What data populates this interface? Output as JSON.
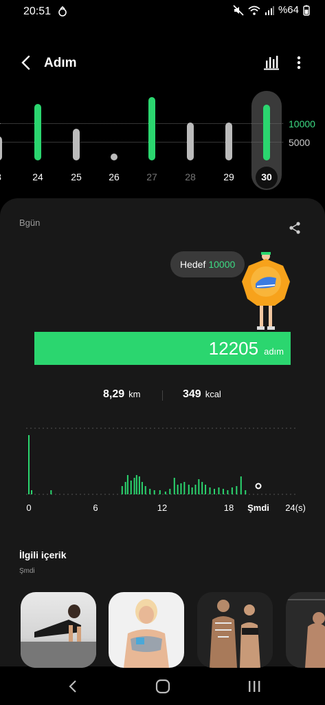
{
  "status_bar": {
    "time": "20:51",
    "battery": "%64"
  },
  "header": {
    "title": "Adım"
  },
  "daily_chart": {
    "goal_labels": [
      "10000",
      "5000"
    ],
    "days": [
      {
        "label": "3",
        "steps": 3000
      },
      {
        "label": "24",
        "steps": 12500
      },
      {
        "label": "25",
        "steps": 5300
      },
      {
        "label": "26",
        "steps": 0
      },
      {
        "label": "27",
        "steps": 14500
      },
      {
        "label": "28",
        "steps": 7000
      },
      {
        "label": "29",
        "steps": 7000
      },
      {
        "label": "30",
        "steps": 12205
      }
    ],
    "selected_day": "30"
  },
  "card": {
    "date_label": "Bgün",
    "goal_prefix": "Hedef",
    "goal_value": "10000",
    "steps_value": "12205",
    "steps_unit": "adım",
    "distance_value": "8,29",
    "distance_unit": "km",
    "calories_value": "349",
    "calories_unit": "kcal"
  },
  "hourly_chart": {
    "x_labels": [
      "0",
      "6",
      "12",
      "18",
      "Şmdi",
      "24(s)"
    ],
    "current_label": "Şmdi"
  },
  "related": {
    "title": "İlgili içerik",
    "subtitle": "Şmdi"
  },
  "colors": {
    "accent": "#2bd66f",
    "card_bg": "#181818",
    "bubble_bg": "#3a3a3a"
  }
}
